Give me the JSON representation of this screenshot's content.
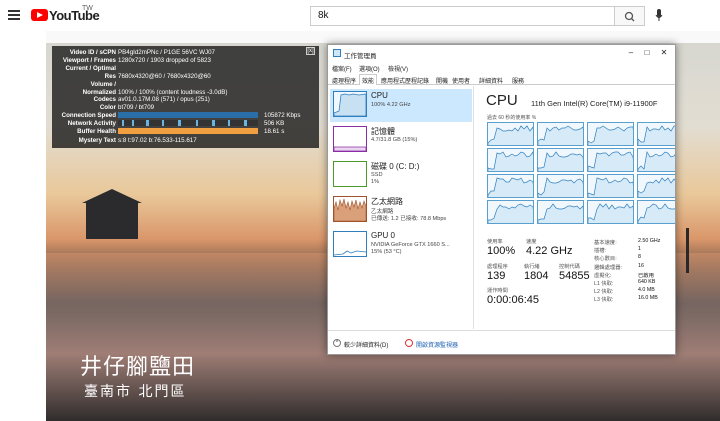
{
  "youtube": {
    "wordmark": "YouTube",
    "country": "TW",
    "search_query": "8k"
  },
  "stats": {
    "rows": [
      {
        "label": "Video ID / sCPN",
        "value": "PB4gId2mPNc / P1GE 56VC WJ07"
      },
      {
        "label": "Viewport / Frames",
        "value": "1280x720 / 1903 dropped of 5823"
      },
      {
        "label": "Current / Optimal",
        "value": ""
      },
      {
        "label": "Res",
        "value": "7680x4320@60 / 7680x4320@60"
      },
      {
        "label": "Volume /",
        "value": ""
      },
      {
        "label": "Normalized",
        "value": "100% / 100% (content loudness -3.0dB)"
      },
      {
        "label": "Codecs",
        "value": "av01.0.17M.08 (571) / opus (251)"
      },
      {
        "label": "Color",
        "value": "bt709 / bt709"
      }
    ],
    "bars": [
      {
        "label": "Connection Speed",
        "value": "105872 Kbps"
      },
      {
        "label": "Network Activity",
        "value": "506 KB"
      },
      {
        "label": "Buffer Health",
        "value": "18.61 s"
      }
    ],
    "mystery": {
      "label": "Mystery Text",
      "value": "s:8 t:97.02 b:76.533-115.617"
    },
    "close": "[x]"
  },
  "caption": {
    "line1": "井仔腳鹽田",
    "line2": "臺南市 北門區"
  },
  "taskmanager": {
    "title": "工作管理員",
    "menu": [
      "檔案(F)",
      "選項(O)",
      "檢視(V)"
    ],
    "tabs": [
      "處理程序",
      "效能",
      "應用程式歷程記錄",
      "開機",
      "使用者",
      "詳細資料",
      "服務"
    ],
    "active_tab": "效能",
    "side": [
      {
        "name": "CPU",
        "sub": [
          "100% 4.22 GHz"
        ],
        "color": "#2f7fbf"
      },
      {
        "name": "記憶體",
        "sub": [
          "4.7/31.8 GB (15%)"
        ],
        "color": "#8b2fa5"
      },
      {
        "name": "磁碟 0 (C: D:)",
        "sub": [
          "SSD",
          "1%"
        ],
        "color": "#4a9a2a"
      },
      {
        "name": "乙太網路",
        "sub": [
          "乙太網路",
          "已傳送: 1.2  已接收: 78.8 Mbps"
        ],
        "color": "#a0522d"
      },
      {
        "name": "GPU 0",
        "sub": [
          "NVIDIA GeForce GTX 1660 S...",
          "15% (53 °C)"
        ],
        "color": "#2f7fbf"
      }
    ],
    "main": {
      "heading": "CPU",
      "model": "11th Gen Intel(R) Core(TM) i9-11900F",
      "graph_label": "過去 60 秒的使用率 %"
    },
    "usage": {
      "label": "使用率",
      "value": "100%",
      "speed_label": "速度",
      "speed_value": "4.22 GHz",
      "processes_label": "處理程序",
      "processes_value": "139",
      "threads_label": "執行緒",
      "threads_value": "1804",
      "handles_label": "控制代碼",
      "handles_value": "54855",
      "uptime_label": "運作時間",
      "uptime_value": "0:00:06:45"
    },
    "specs": [
      {
        "label": "基本速度:",
        "value": "2.50 GHz"
      },
      {
        "label": "插槽:",
        "value": "1"
      },
      {
        "label": "核心數目:",
        "value": "8"
      },
      {
        "label": "邏輯處理器:",
        "value": "16"
      },
      {
        "label": "虛擬化:",
        "value": "已啟用"
      },
      {
        "label": "L1 快取:",
        "value": "640 KB"
      },
      {
        "label": "L2 快取:",
        "value": "4.0 MB"
      },
      {
        "label": "L3 快取:",
        "value": "16.0 MB"
      }
    ],
    "footer": {
      "less_details": "較少詳細資料(D)",
      "resource_monitor": "開啟資源監視器"
    }
  },
  "colors": {
    "youtube_red": "#ff0000",
    "cpu_blue": "#2f7fbf",
    "selected_bg": "#cce8ff"
  }
}
